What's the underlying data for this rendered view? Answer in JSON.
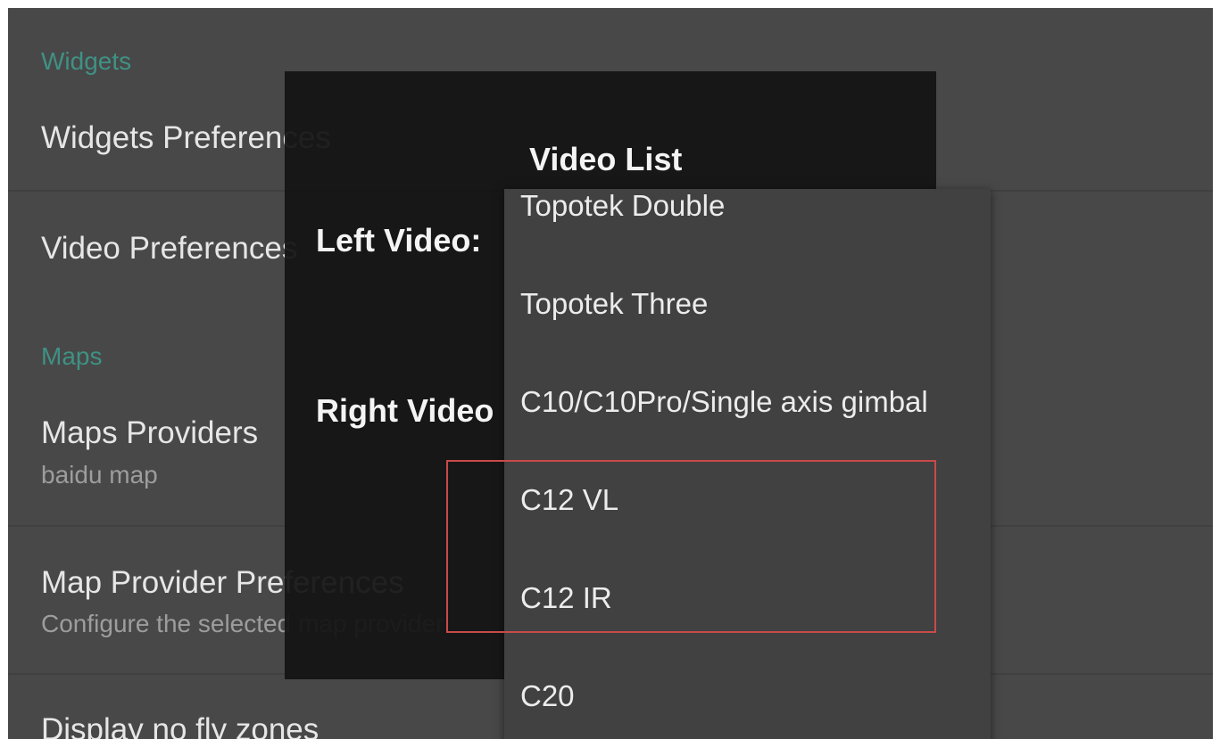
{
  "settings": {
    "widgets_header": "Widgets",
    "widgets_preferences": "Widgets Preferences",
    "video_preferences": "Video Preferences",
    "maps_header": "Maps",
    "maps_providers": {
      "title": "Maps Providers",
      "summary": "baidu map"
    },
    "map_provider_preferences": {
      "title": "Map Provider Preferences",
      "summary": "Configure the selected map provider"
    },
    "display_no_fly_zones": "Display no fly zones"
  },
  "dialog": {
    "title": "Video List",
    "left_video_label": "Left Video:",
    "right_video_label": "Right Video"
  },
  "dropdown": {
    "items": [
      "Topotek Double",
      "Topotek Three",
      "C10/C10Pro/Single axis gimbal",
      "C12 VL",
      "C12 IR",
      "C20"
    ]
  },
  "colors": {
    "background": "#484848",
    "accent_header": "#3f9184",
    "dialog": "#141414",
    "dropdown": "#414141",
    "highlight_box": "#c94a4a"
  }
}
